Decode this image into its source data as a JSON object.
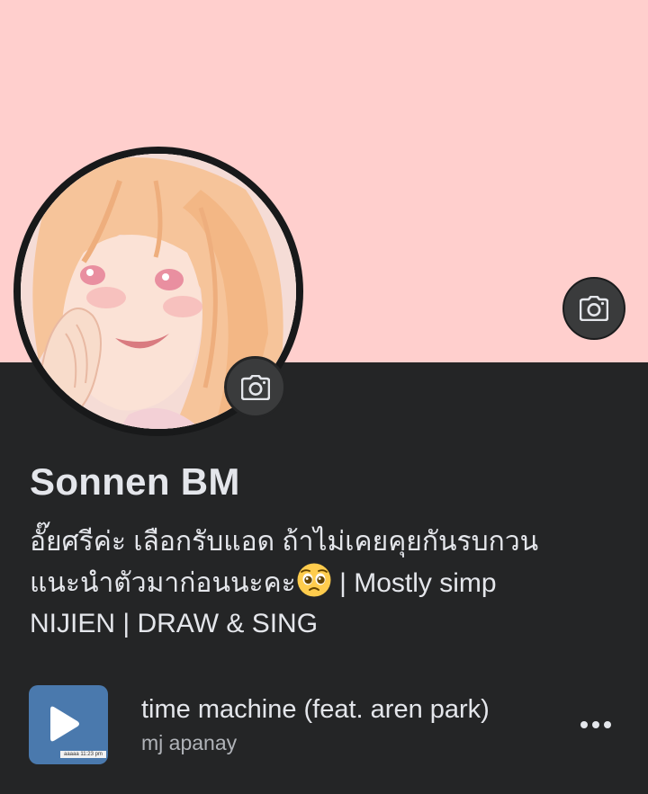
{
  "profile": {
    "name": "Sonnen BM",
    "bio_line_1": "อั๊ยศรีค่ะ เลือกรับแอด ถ้าไม่เคยคุยกันรบกวน",
    "bio_line_2_pre": "แนะนำตัวมาก่อนนะคะ",
    "bio_emoji": "pleading-face-emoji",
    "bio_line_2_post": " | Mostly simp",
    "bio_line_3": "NIJIEN | DRAW & SING"
  },
  "music": {
    "title": "time machine (feat. aren park)",
    "artist": "mj apanay",
    "album_caption": "aaaaa 11:23 pm"
  },
  "icons": {
    "cover_camera": "camera-icon",
    "avatar_camera": "camera-icon",
    "play": "play-icon",
    "more": "more-options-icon"
  },
  "colors": {
    "cover_background": "#ffcfcd",
    "page_background": "#242526",
    "button_background": "#3a3b3c",
    "primary_text": "#e4e6eb",
    "secondary_text": "#b0b3b8",
    "album_art": "#4a79ad"
  }
}
